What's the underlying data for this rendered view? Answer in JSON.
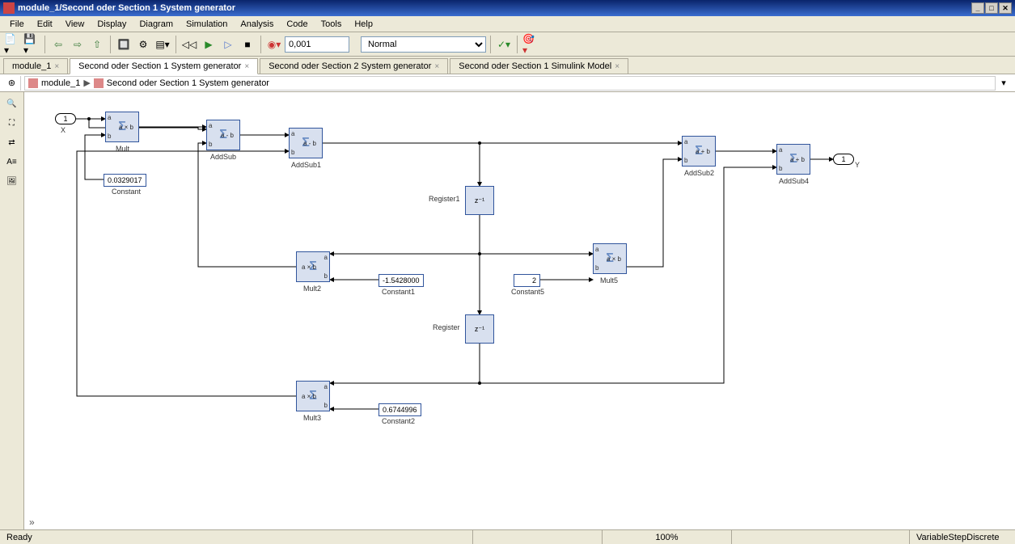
{
  "window": {
    "title": "module_1/Second oder Section 1 System generator"
  },
  "menu": {
    "items": [
      "File",
      "Edit",
      "View",
      "Display",
      "Diagram",
      "Simulation",
      "Analysis",
      "Code",
      "Tools",
      "Help"
    ]
  },
  "toolbar": {
    "stop_time": "0,001",
    "sim_mode": "Normal"
  },
  "tabs": [
    {
      "label": "module_1",
      "active": false
    },
    {
      "label": "Second oder Section 1 System generator",
      "active": true
    },
    {
      "label": "Second oder Section 2 System generator",
      "active": false
    },
    {
      "label": "Second oder Section 1 Simulink Model",
      "active": false
    }
  ],
  "breadcrumb": {
    "root": "module_1",
    "current": "Second oder Section 1 System generator"
  },
  "blocks": {
    "inport": {
      "num": "1",
      "label": "X"
    },
    "outport": {
      "num": "1",
      "label": "Y"
    },
    "mult": {
      "op": "a × b",
      "label": "Mult"
    },
    "constant": {
      "value": "0.0329017",
      "label": "Constant"
    },
    "addsub": {
      "op": "a - b",
      "label": "AddSub"
    },
    "addsub1": {
      "op": "a - b",
      "label": "AddSub1"
    },
    "addsub2": {
      "op": "a + b",
      "label": "AddSub2"
    },
    "addsub4": {
      "op": "a + b",
      "label": "AddSub4"
    },
    "register1": {
      "op": "z⁻¹",
      "label": "Register1"
    },
    "register": {
      "op": "z⁻¹",
      "label": "Register"
    },
    "mult2": {
      "op": "a × b",
      "label": "Mult2"
    },
    "constant1": {
      "value": "-1.5428000",
      "label": "Constant1"
    },
    "constant5": {
      "value": "2",
      "label": "Constant5"
    },
    "mult5": {
      "op": "a × b",
      "label": "Mult5"
    },
    "mult3": {
      "op": "a × b",
      "label": "Mult3"
    },
    "constant2": {
      "value": "0.6744996",
      "label": "Constant2"
    }
  },
  "status": {
    "ready": "Ready",
    "zoom": "100%",
    "solver": "VariableStepDiscrete"
  }
}
